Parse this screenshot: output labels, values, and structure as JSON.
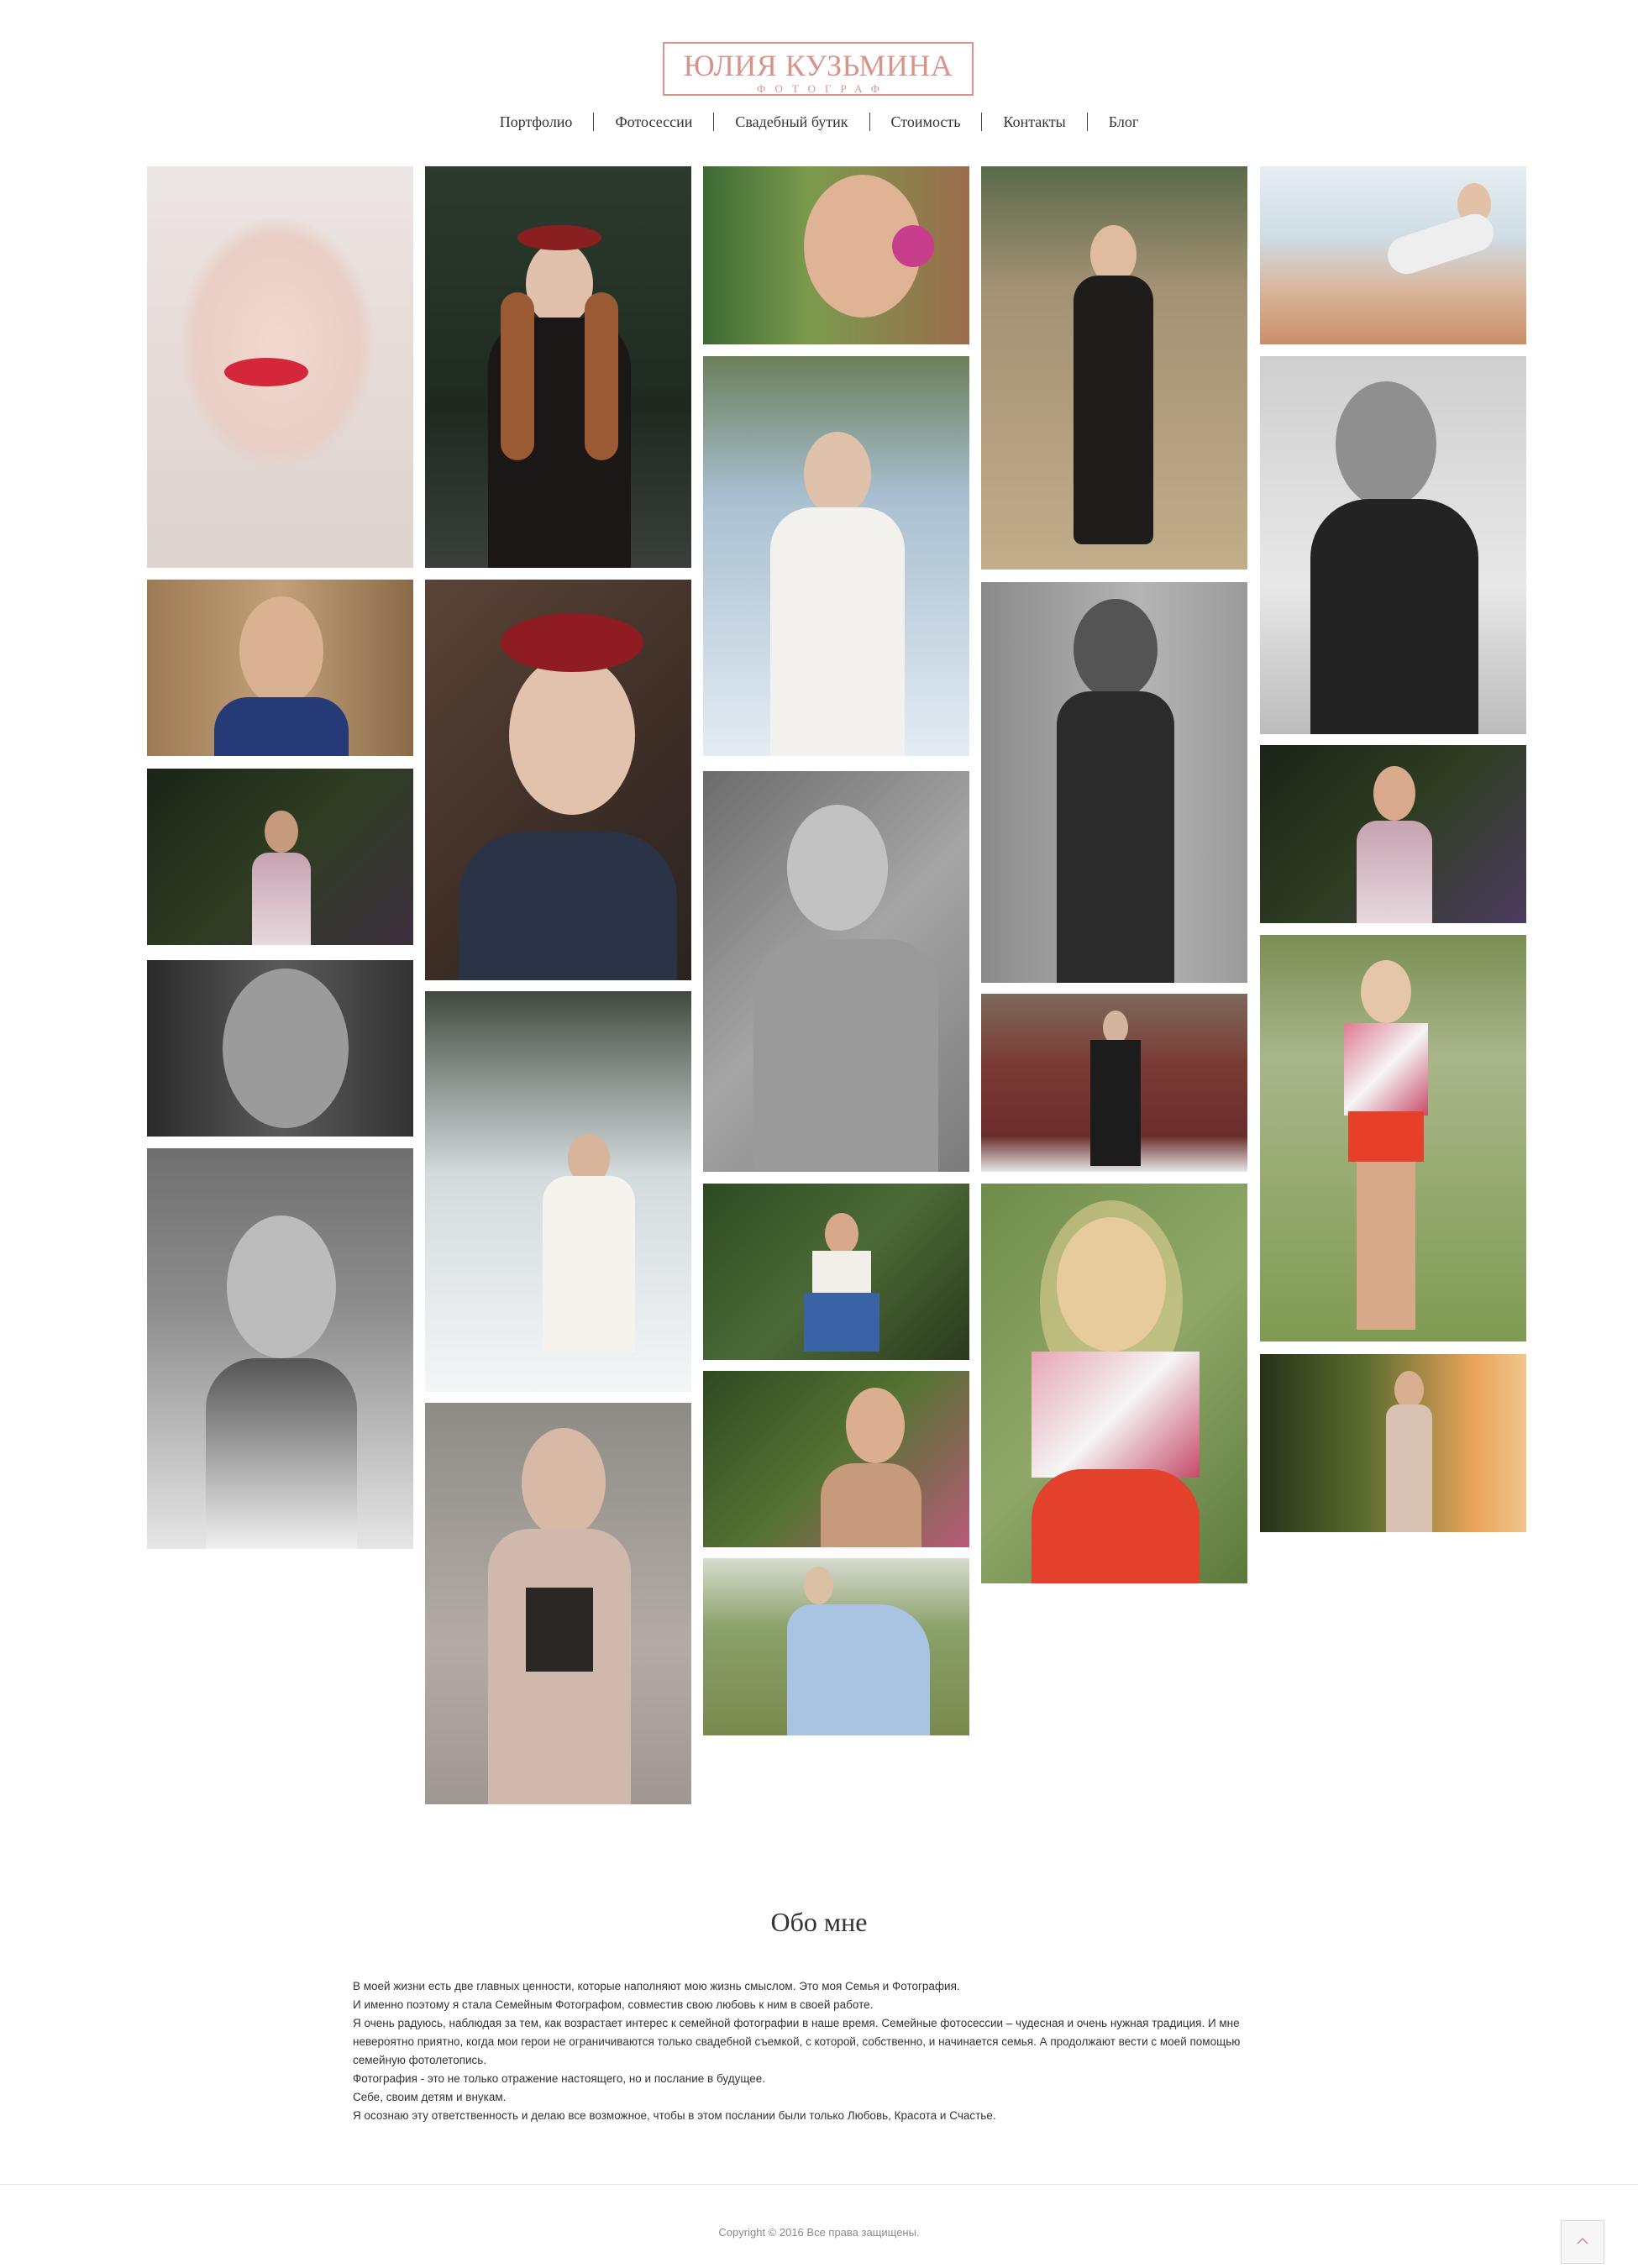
{
  "logo": {
    "title": "ЮЛИЯ КУЗЬМИНА",
    "subtitle": "ФОТОГРАФ"
  },
  "nav": {
    "items": [
      "Портфолио",
      "Фотосессии",
      "Свадебный бутик",
      "Стоимость",
      "Контакты",
      "Блог"
    ]
  },
  "about": {
    "title": "Обо мне",
    "paragraphs": [
      "В моей жизни есть две главных ценности, которые наполняют мою жизнь смыслом. Это моя Семья и Фотография.",
      "И именно поэтому я стала Семейным Фотографом, совместив свою любовь к ним в своей работе.",
      "Я очень радуюсь, наблюдая за тем, как возрастает интерес к семейной фотографии в наше время. Семейные фотосессии – чудесная и очень нужная традиция. И мне невероятно приятно, когда мои герои не ограничиваются только свадебной съемкой, с которой, собственно, и начинается семья. А продолжают вести с моей помощью семейную фотолетопись.",
      "Фотография - это не только отражение настоящего, но и послание в будущее.",
      "Себе, своим детям и внукам.",
      "Я осознаю эту ответственность и делаю все возможное, чтобы в этом послании были только Любовь, Красота и Счастье."
    ]
  },
  "footer": {
    "copyright": "Copyright  ©  2016 Все права защищены."
  },
  "to_top_icon": "arrow-up-icon",
  "colors": {
    "accent": "#d9938d"
  }
}
